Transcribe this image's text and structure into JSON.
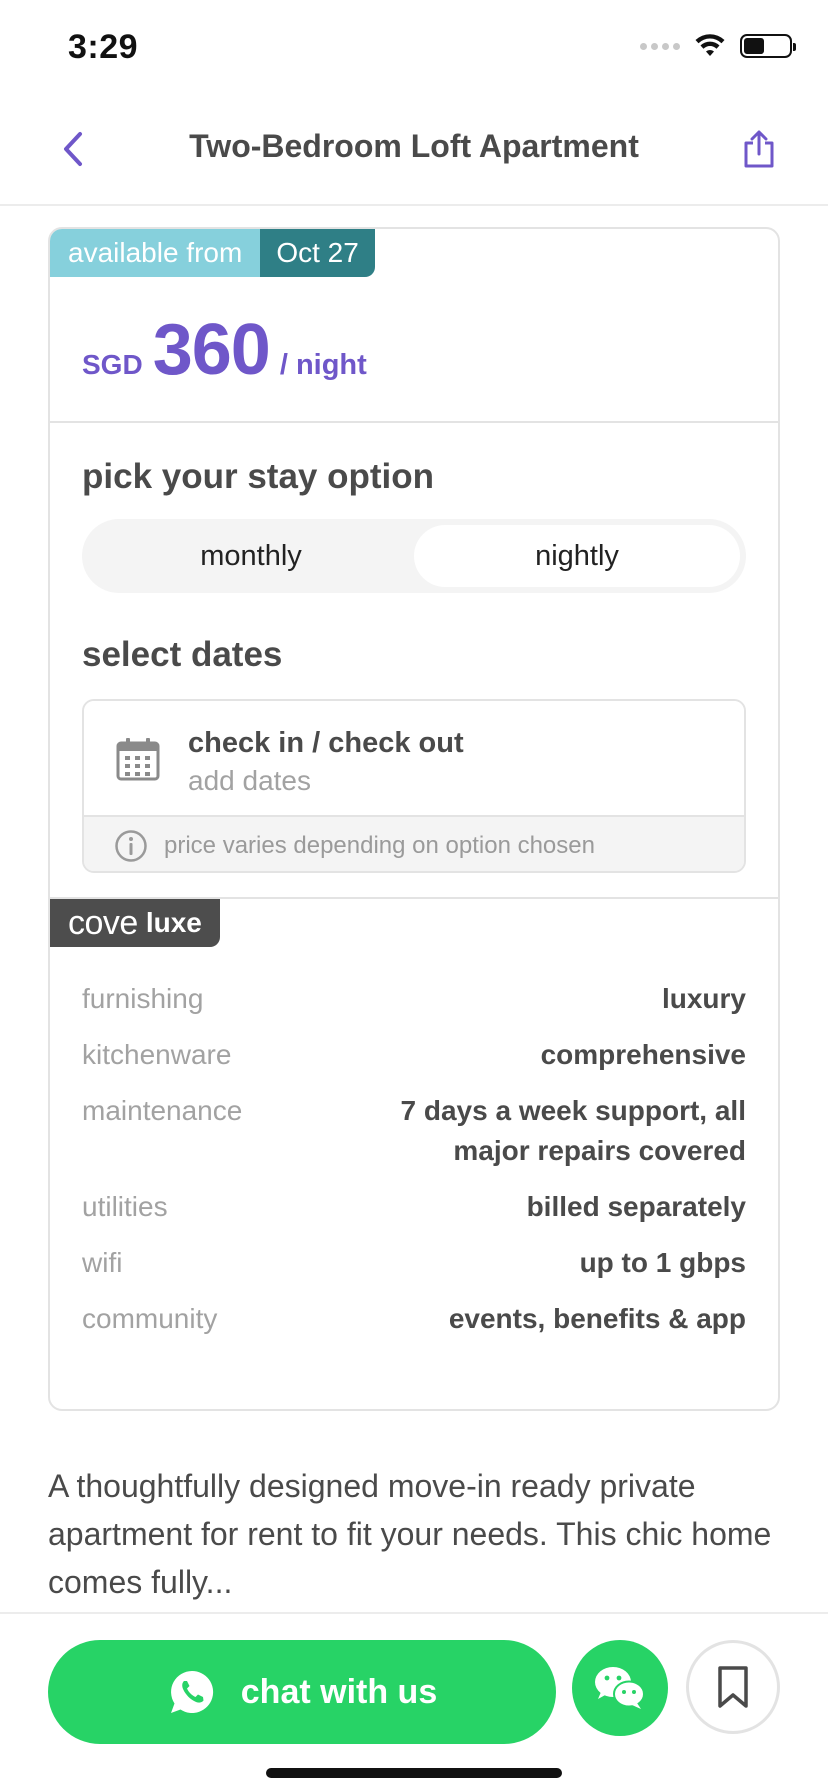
{
  "status_bar": {
    "time": "3:29"
  },
  "nav": {
    "title": "Two-Bedroom Loft Apartment",
    "back_icon": "chevron-left-icon",
    "share_icon": "share-icon"
  },
  "availability": {
    "label": "available from",
    "date": "Oct 27"
  },
  "price": {
    "currency": "SGD",
    "amount": "360",
    "unit": "/ night"
  },
  "stay": {
    "title": "pick your stay option",
    "options": [
      {
        "label": "monthly",
        "selected": false
      },
      {
        "label": "nightly",
        "selected": true
      }
    ]
  },
  "dates": {
    "title": "select dates",
    "field_label": "check in / check out",
    "field_placeholder": "add dates",
    "note": "price varies depending on option chosen"
  },
  "tier": {
    "brand": "cove",
    "name": "luxe"
  },
  "specs": [
    {
      "label": "furnishing",
      "value": "luxury"
    },
    {
      "label": "kitchenware",
      "value": "comprehensive"
    },
    {
      "label": "maintenance",
      "value": "7 days a week support, all major repairs covered"
    },
    {
      "label": "utilities",
      "value": "billed separately"
    },
    {
      "label": "wifi",
      "value": "up to 1 gbps"
    },
    {
      "label": "community",
      "value": "events, benefits & app"
    }
  ],
  "description": "A thoughtfully designed move-in ready private apartment for rent to fit your needs. This chic home comes fully...",
  "actions": {
    "chat_label": "chat with us"
  },
  "colors": {
    "accent": "#6f57c9",
    "green": "#27d366",
    "teal_light": "#86d0dc",
    "teal_dark": "#2f7f86",
    "badge_dark": "#4d4d4d"
  }
}
